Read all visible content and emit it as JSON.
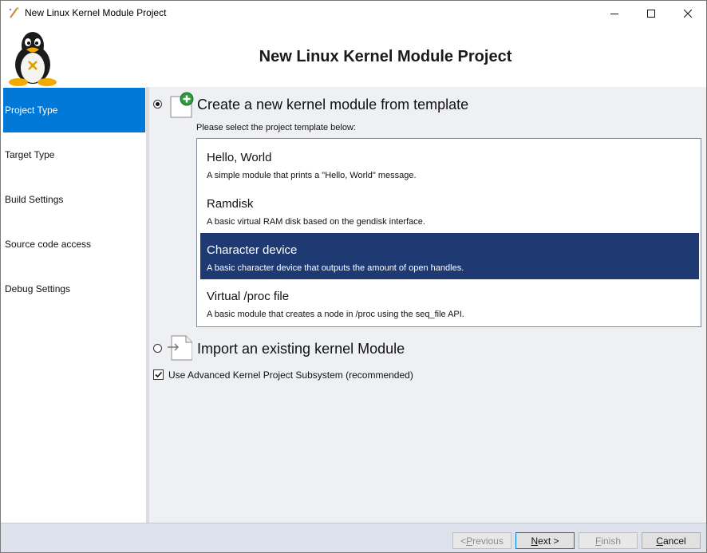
{
  "window": {
    "title": "New Linux Kernel Module Project",
    "controls": {
      "minimize_icon": "minimize-icon",
      "maximize_icon": "maximize-icon",
      "close_icon": "close-icon"
    }
  },
  "header": {
    "title": "New Linux Kernel Module Project",
    "logo_icon": "tux-penguin-logo"
  },
  "sidebar": {
    "items": [
      {
        "label": "Project Type",
        "active": true
      },
      {
        "label": "Target Type",
        "active": false
      },
      {
        "label": "Build Settings",
        "active": false
      },
      {
        "label": "Source code access",
        "active": false
      },
      {
        "label": "Debug Settings",
        "active": false
      }
    ]
  },
  "main": {
    "create_option": {
      "label": "Create a new kernel module from template",
      "selected": true,
      "icon": "new-document-plus-icon"
    },
    "template_hint": "Please select the project template below:",
    "templates": [
      {
        "name": "Hello, World",
        "description": "A simple module that prints a \"Hello, World\" message.",
        "selected": false
      },
      {
        "name": "Ramdisk",
        "description": "A basic virtual RAM disk based on the gendisk interface.",
        "selected": false
      },
      {
        "name": "Character device",
        "description": "A basic character device that outputs the amount of open handles.",
        "selected": true
      },
      {
        "name": "Virtual /proc file",
        "description": "A basic module that creates a node in /proc using the seq_file API.",
        "selected": false
      }
    ],
    "import_option": {
      "label": "Import an existing kernel Module",
      "selected": false,
      "icon": "import-document-icon"
    },
    "advanced_checkbox": {
      "label": "Use Advanced Kernel Project Subsystem (recommended)",
      "checked": true
    }
  },
  "footer": {
    "previous": {
      "label_prefix": "< ",
      "label_mnemonic": "P",
      "label_rest": "revious",
      "enabled": false
    },
    "next": {
      "label_mnemonic": "N",
      "label_rest": "ext >",
      "enabled": true
    },
    "finish": {
      "label_mnemonic": "F",
      "label_rest": "inish",
      "enabled": false
    },
    "cancel": {
      "label_mnemonic": "C",
      "label_rest": "ancel",
      "enabled": true
    }
  },
  "colors": {
    "accent": "#0078d7",
    "selection": "#1f3a73",
    "content_bg": "#eef0f3",
    "footer_bg": "#dde2ec"
  }
}
